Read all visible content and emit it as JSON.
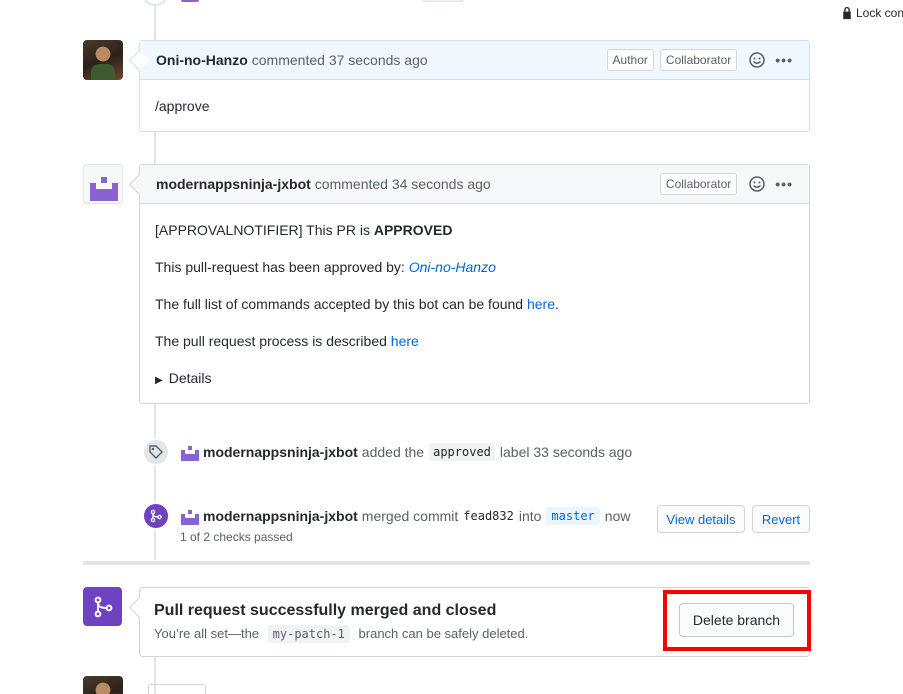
{
  "lock": {
    "label": "Lock con"
  },
  "comments": [
    {
      "author": "Oni-no-Hanzo",
      "action": "commented",
      "time": "37 seconds ago",
      "labels": [
        "Author",
        "Collaborator"
      ],
      "body": "/approve"
    },
    {
      "author": "modernappsninja-jxbot",
      "action": "commented",
      "time": "34 seconds ago",
      "labels": [
        "Collaborator"
      ],
      "line1_prefix": "[APPROVALNOTIFIER] This PR is ",
      "line1_bold": "APPROVED",
      "line2_prefix": "This pull-request has been approved by: ",
      "line2_link": "Oni-no-Hanzo",
      "line3_prefix": "The full list of commands accepted by this bot can be found ",
      "line3_link": "here",
      "line3_suffix": ".",
      "line4_prefix": "The pull request process is described ",
      "line4_link": "here",
      "details": "Details"
    }
  ],
  "label_event": {
    "actor": "modernappsninja-jxbot",
    "text_before": "added the",
    "label": "approved",
    "text_after": "label 33 seconds ago"
  },
  "merge_event": {
    "actor": "modernappsninja-jxbot",
    "text_before": "merged commit",
    "commit": "fead832",
    "text_into": "into",
    "branch": "master",
    "time": "now",
    "checks": "1 of 2 checks passed",
    "view_details": "View details",
    "revert": "Revert"
  },
  "merged_panel": {
    "title": "Pull request successfully merged and closed",
    "sub_before": "You’re all set—the",
    "branch": "my-patch-1",
    "sub_after": "branch can be safely deleted.",
    "delete_button": "Delete branch"
  },
  "colors": {
    "merged_purple": "#6f42c1",
    "link_blue": "#0366d6",
    "highlight_red": "#ff0000"
  }
}
